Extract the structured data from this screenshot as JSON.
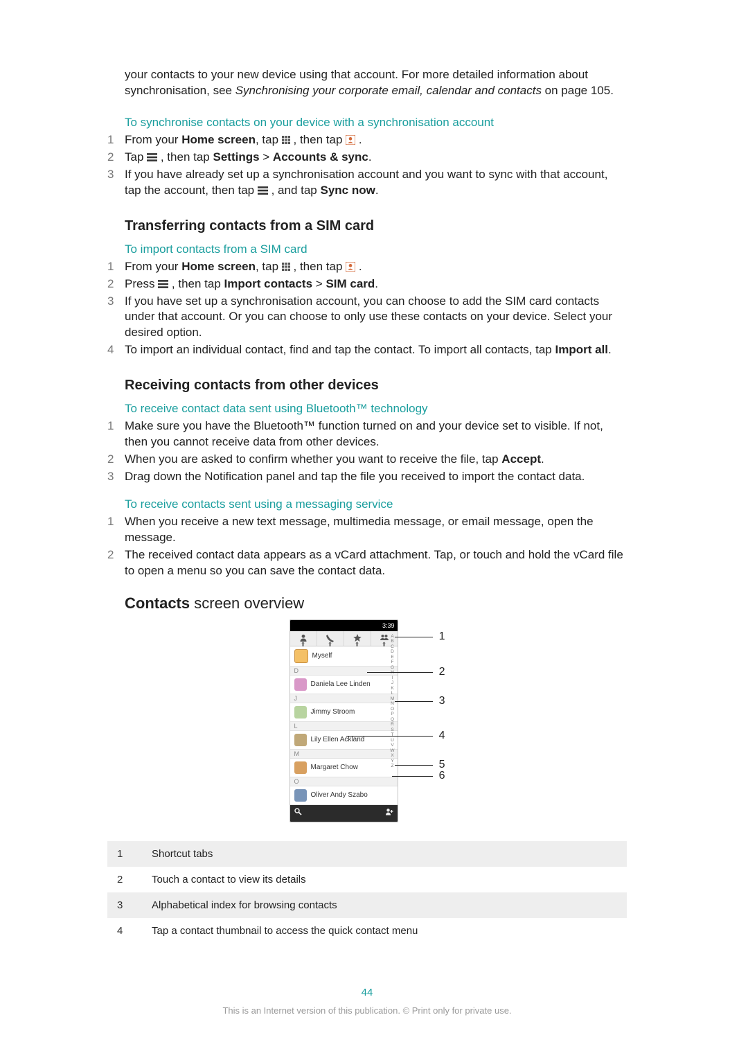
{
  "intro": {
    "line1_prefix": "your contacts to your new device using that account. For more detailed information about synchronisation, see ",
    "line1_italic": "Synchronising your corporate email, calendar and contacts",
    "line1_suffix": " on page 105."
  },
  "sec_sync": {
    "heading": "To synchronise contacts on your device with a synchronisation account",
    "steps": [
      {
        "html": "From your <b>Home screen</b>, tap {grid} , then tap {contact} ."
      },
      {
        "html": "Tap {menu} , then tap <b>Settings</b> > <b>Accounts & sync</b>."
      },
      {
        "html": "If you have already set up a synchronisation account and you want to sync with that account, tap the account, then tap {menu} , and tap <b>Sync now</b>."
      }
    ]
  },
  "sec_transfer": {
    "heading": "Transferring contacts from a SIM card",
    "sub": "To import contacts from a SIM card",
    "steps": [
      {
        "html": "From your <b>Home screen</b>, tap {grid} , then tap {contact} ."
      },
      {
        "html": "Press {menu} , then tap <b>Import contacts</b> > <b>SIM card</b>."
      },
      {
        "html": "If you have set up a synchronisation account, you can choose to add the SIM card contacts under that account. Or you can choose to only use these contacts on your device. Select your desired option."
      },
      {
        "html": "To import an individual contact, find and tap the contact. To import all contacts, tap <b>Import all</b>."
      }
    ]
  },
  "sec_receive": {
    "heading": "Receiving contacts from other devices",
    "bt_sub": "To receive contact data sent using Bluetooth™ technology",
    "bt_steps": [
      {
        "html": "Make sure you have the Bluetooth™ function turned on and your device set to visible. If not, then you cannot receive data from other devices."
      },
      {
        "html": "When you are asked to confirm whether you want to receive the file, tap <b>Accept</b>."
      },
      {
        "html": "Drag down the Notification panel and tap the file you received to import the contact data."
      }
    ],
    "msg_sub": "To receive contacts sent using a messaging service",
    "msg_steps": [
      {
        "html": "When you receive a new text message, multimedia message, or email message, open the message."
      },
      {
        "html": "The received contact data appears as a vCard attachment. Tap, or touch and hold the vCard file to open a menu so you can save the contact data."
      }
    ]
  },
  "overview": {
    "heading_bold": "Contacts",
    "heading_rest": " screen overview",
    "status_time": "3:39",
    "myself": "Myself",
    "contacts": [
      {
        "letter": "D",
        "name": "Daniela Lee Linden",
        "avatar": "#d998c8"
      },
      {
        "letter": "J",
        "name": "Jimmy Stroom",
        "avatar": "#b8d4a0"
      },
      {
        "letter": "L",
        "name": "Lily Ellen Ackland",
        "avatar": "#c0a878"
      },
      {
        "letter": "M",
        "name": "Margaret Chow",
        "avatar": "#d8a060"
      },
      {
        "letter": "O",
        "name": "Oliver Andy Szabo",
        "avatar": "#7894b8"
      }
    ],
    "az": "ABCDEFGHIJKLMNOPQRSTUVWXYZ",
    "callouts": [
      "1",
      "2",
      "3",
      "4",
      "5",
      "6"
    ],
    "legend": [
      {
        "n": "1",
        "text": "Shortcut tabs"
      },
      {
        "n": "2",
        "text": "Touch a contact to view its details"
      },
      {
        "n": "3",
        "text": "Alphabetical index for browsing contacts"
      },
      {
        "n": "4",
        "text": "Tap a contact thumbnail to access the quick contact menu"
      }
    ]
  },
  "footer": {
    "page_number": "44",
    "notice": "This is an Internet version of this publication. © Print only for private use."
  },
  "colors": {
    "teal": "#1a9e9e",
    "orange": "#d46a3b"
  }
}
